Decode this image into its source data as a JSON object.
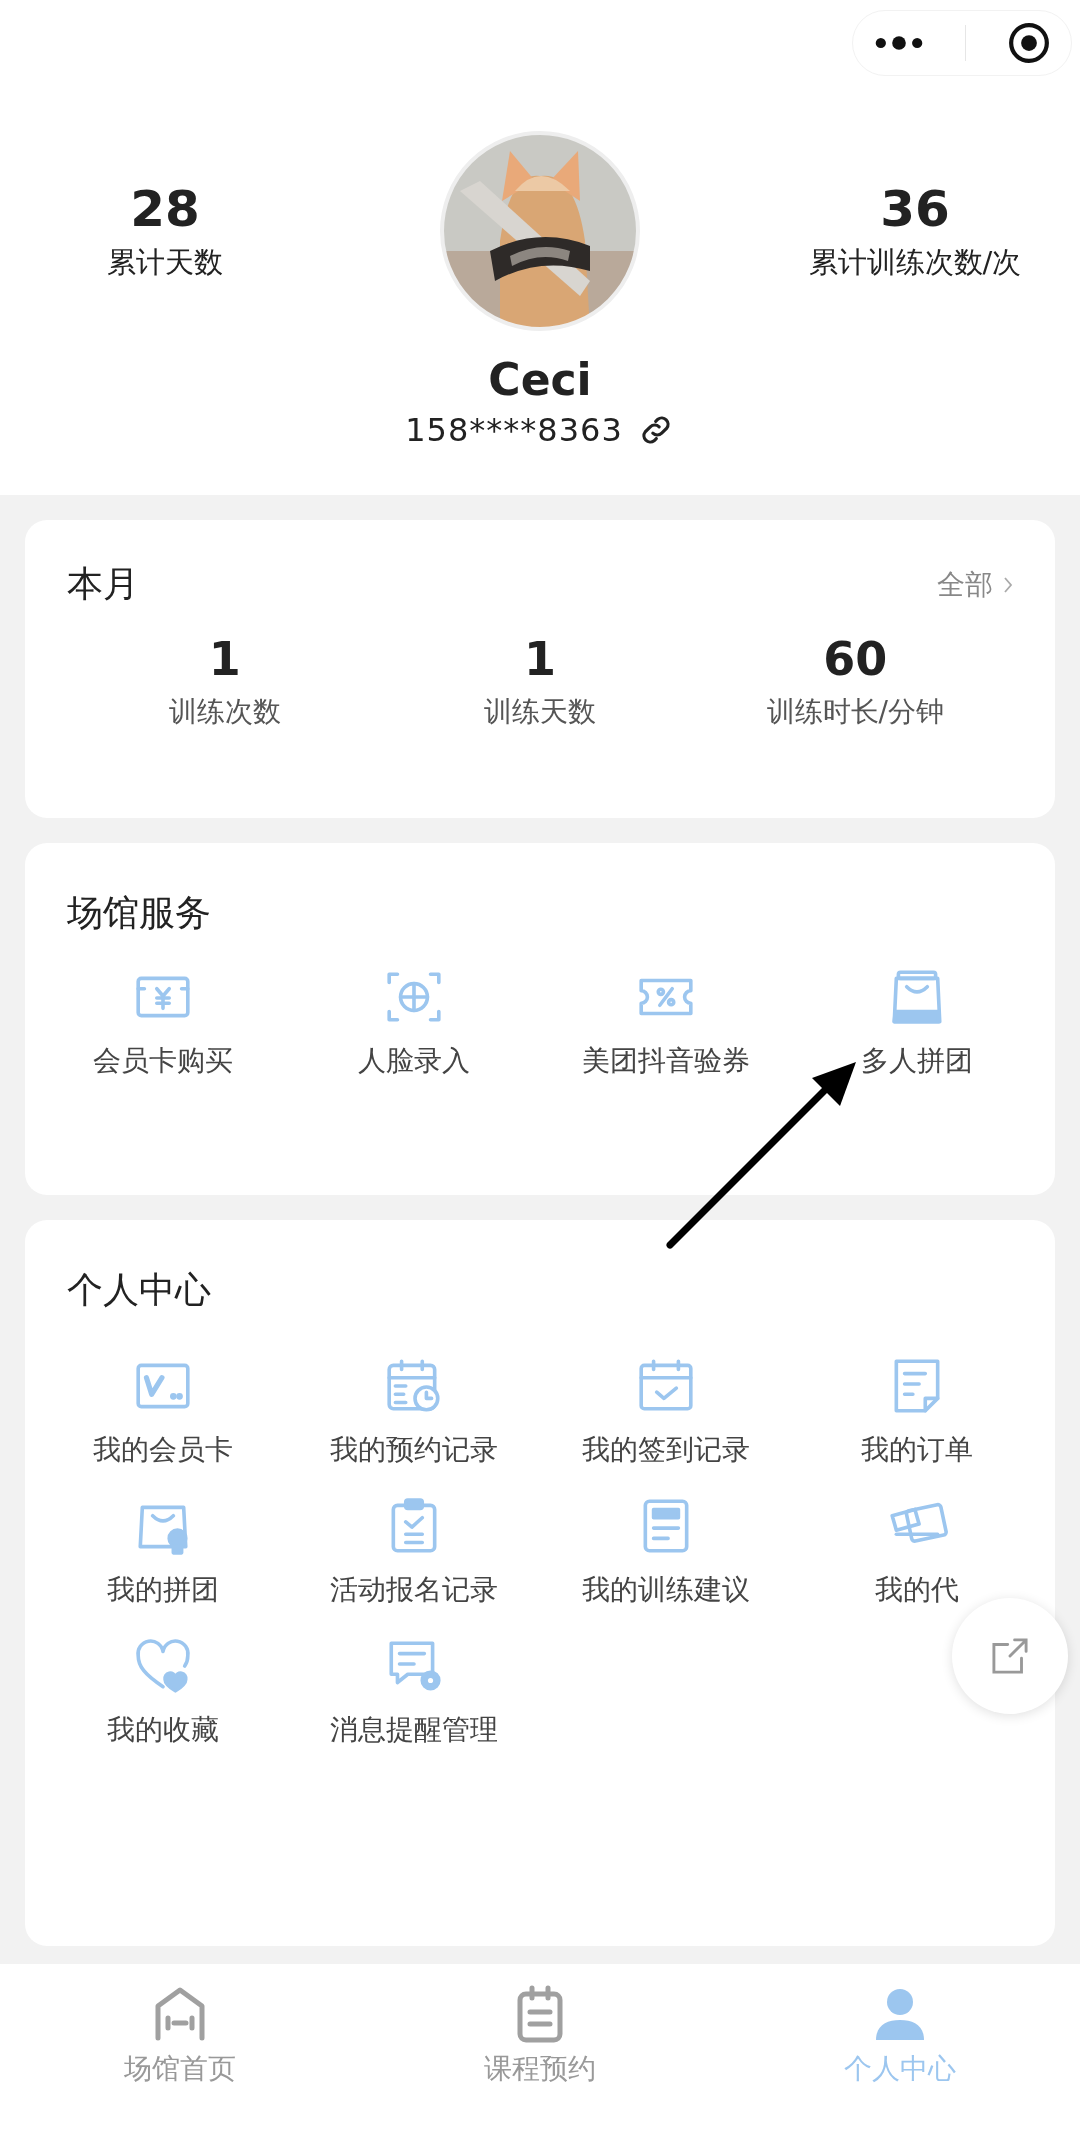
{
  "profile": {
    "stats": [
      {
        "value": "28",
        "label": "累计天数"
      },
      {
        "value": "36",
        "label": "累计训练次数/次"
      }
    ],
    "name": "Ceci",
    "phone": "158****8363"
  },
  "month": {
    "title": "本月",
    "more": "全部",
    "stats": [
      {
        "value": "1",
        "label": "训练次数"
      },
      {
        "value": "1",
        "label": "训练天数"
      },
      {
        "value": "60",
        "label": "训练时长/分钟"
      }
    ]
  },
  "services": {
    "title": "场馆服务",
    "items": [
      {
        "kind": "card",
        "label": "会员卡购买"
      },
      {
        "kind": "face",
        "label": "人脸录入"
      },
      {
        "kind": "coupon",
        "label": "美团抖音验券"
      },
      {
        "kind": "bag",
        "label": "多人拼团"
      }
    ]
  },
  "personal": {
    "title": "个人中心",
    "items": [
      {
        "kind": "vcard",
        "label": "我的会员卡"
      },
      {
        "kind": "calclock",
        "label": "我的预约记录"
      },
      {
        "kind": "calcheck",
        "label": "我的签到记录"
      },
      {
        "kind": "doc",
        "label": "我的订单"
      },
      {
        "kind": "bagpin",
        "label": "我的拼团"
      },
      {
        "kind": "clipboard",
        "label": "活动报名记录"
      },
      {
        "kind": "note",
        "label": "我的训练建议"
      },
      {
        "kind": "tickets",
        "label": "我的代"
      },
      {
        "kind": "heart",
        "label": "我的收藏"
      },
      {
        "kind": "msggear",
        "label": "消息提醒管理"
      }
    ]
  },
  "tabbar": [
    {
      "kind": "home",
      "label": "场馆首页",
      "selected": false
    },
    {
      "kind": "clip",
      "label": "课程预约",
      "selected": false
    },
    {
      "kind": "person",
      "label": "个人中心",
      "selected": true
    }
  ]
}
